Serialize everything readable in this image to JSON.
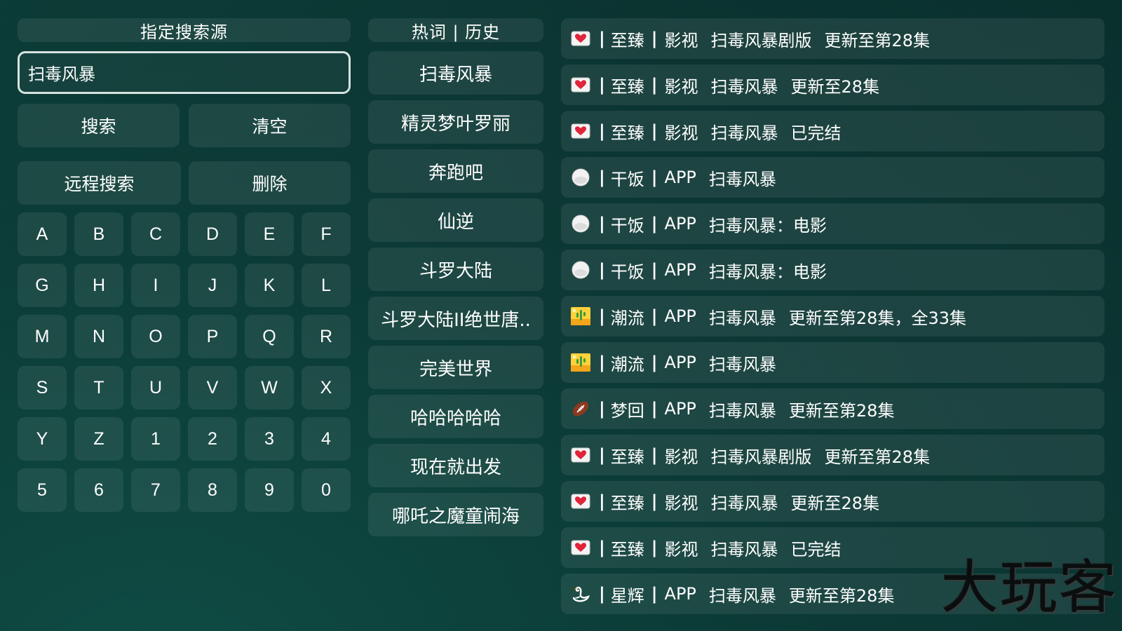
{
  "left": {
    "source_header": "指定搜索源",
    "search_value": "扫毒风暴",
    "buttons": {
      "search": "搜索",
      "clear": "清空",
      "remote_search": "远程搜索",
      "delete": "删除"
    },
    "keys": [
      "A",
      "B",
      "C",
      "D",
      "E",
      "F",
      "G",
      "H",
      "I",
      "J",
      "K",
      "L",
      "M",
      "N",
      "O",
      "P",
      "Q",
      "R",
      "S",
      "T",
      "U",
      "V",
      "W",
      "X",
      "Y",
      "Z",
      "1",
      "2",
      "3",
      "4",
      "5",
      "6",
      "7",
      "8",
      "9",
      "0"
    ]
  },
  "middle": {
    "header": "热词 | 历史",
    "items": [
      "扫毒风暴",
      "精灵梦叶罗丽",
      "奔跑吧",
      "仙逆",
      "斗罗大陆",
      "斗罗大陆II绝世唐..",
      "完美世界",
      "哈哈哈哈哈",
      "现在就出发",
      "哪吒之魔童闹海"
    ]
  },
  "results": [
    {
      "icon": "heart-card-icon",
      "bar1": "|",
      "source": "至臻",
      "bar2": "|",
      "type": "影视",
      "title": "扫毒风暴剧版",
      "status": "更新至第28集"
    },
    {
      "icon": "heart-card-icon",
      "bar1": "|",
      "source": "至臻",
      "bar2": "|",
      "type": "影视",
      "title": "扫毒风暴",
      "status": "更新至28集"
    },
    {
      "icon": "heart-card-icon",
      "bar1": "|",
      "source": "至臻",
      "bar2": "|",
      "type": "影视",
      "title": "扫毒风暴",
      "status": "已完结"
    },
    {
      "icon": "rice-ball-icon",
      "bar1": "|",
      "source": "干饭",
      "bar2": "|",
      "type": "APP",
      "title": "扫毒风暴",
      "status": ""
    },
    {
      "icon": "rice-ball-icon",
      "bar1": "|",
      "source": "干饭",
      "bar2": "|",
      "type": "APP",
      "title": "扫毒风暴：电影",
      "status": ""
    },
    {
      "icon": "rice-ball-icon",
      "bar1": "|",
      "source": "干饭",
      "bar2": "|",
      "type": "APP",
      "title": "扫毒风暴：电影",
      "status": ""
    },
    {
      "icon": "desert-cactus-icon",
      "bar1": "|",
      "source": "潮流",
      "bar2": "|",
      "type": "APP",
      "title": "扫毒风暴",
      "status": "更新至第28集，全33集"
    },
    {
      "icon": "desert-cactus-icon",
      "bar1": "|",
      "source": "潮流",
      "bar2": "|",
      "type": "APP",
      "title": "扫毒风暴",
      "status": ""
    },
    {
      "icon": "football-icon",
      "bar1": "|",
      "source": "梦回",
      "bar2": "|",
      "type": "APP",
      "title": "扫毒风暴",
      "status": "更新至第28集"
    },
    {
      "icon": "heart-card-icon",
      "bar1": "|",
      "source": "至臻",
      "bar2": "|",
      "type": "影视",
      "title": "扫毒风暴剧版",
      "status": "更新至第28集"
    },
    {
      "icon": "heart-card-icon",
      "bar1": "|",
      "source": "至臻",
      "bar2": "|",
      "type": "影视",
      "title": "扫毒风暴",
      "status": "更新至28集"
    },
    {
      "icon": "heart-card-icon",
      "bar1": "|",
      "source": "至臻",
      "bar2": "|",
      "type": "影视",
      "title": "扫毒风暴",
      "status": "已完结"
    },
    {
      "icon": "swan-icon",
      "bar1": "|",
      "source": "星辉",
      "bar2": "|",
      "type": "APP",
      "title": "扫毒风暴",
      "status": "更新至第28集"
    }
  ],
  "watermark": "大玩客",
  "colors": {
    "background": "#0c3a36",
    "panel": "rgba(255,255,255,0.075)",
    "input_border": "#d7e2df",
    "text": "#ffffff"
  }
}
